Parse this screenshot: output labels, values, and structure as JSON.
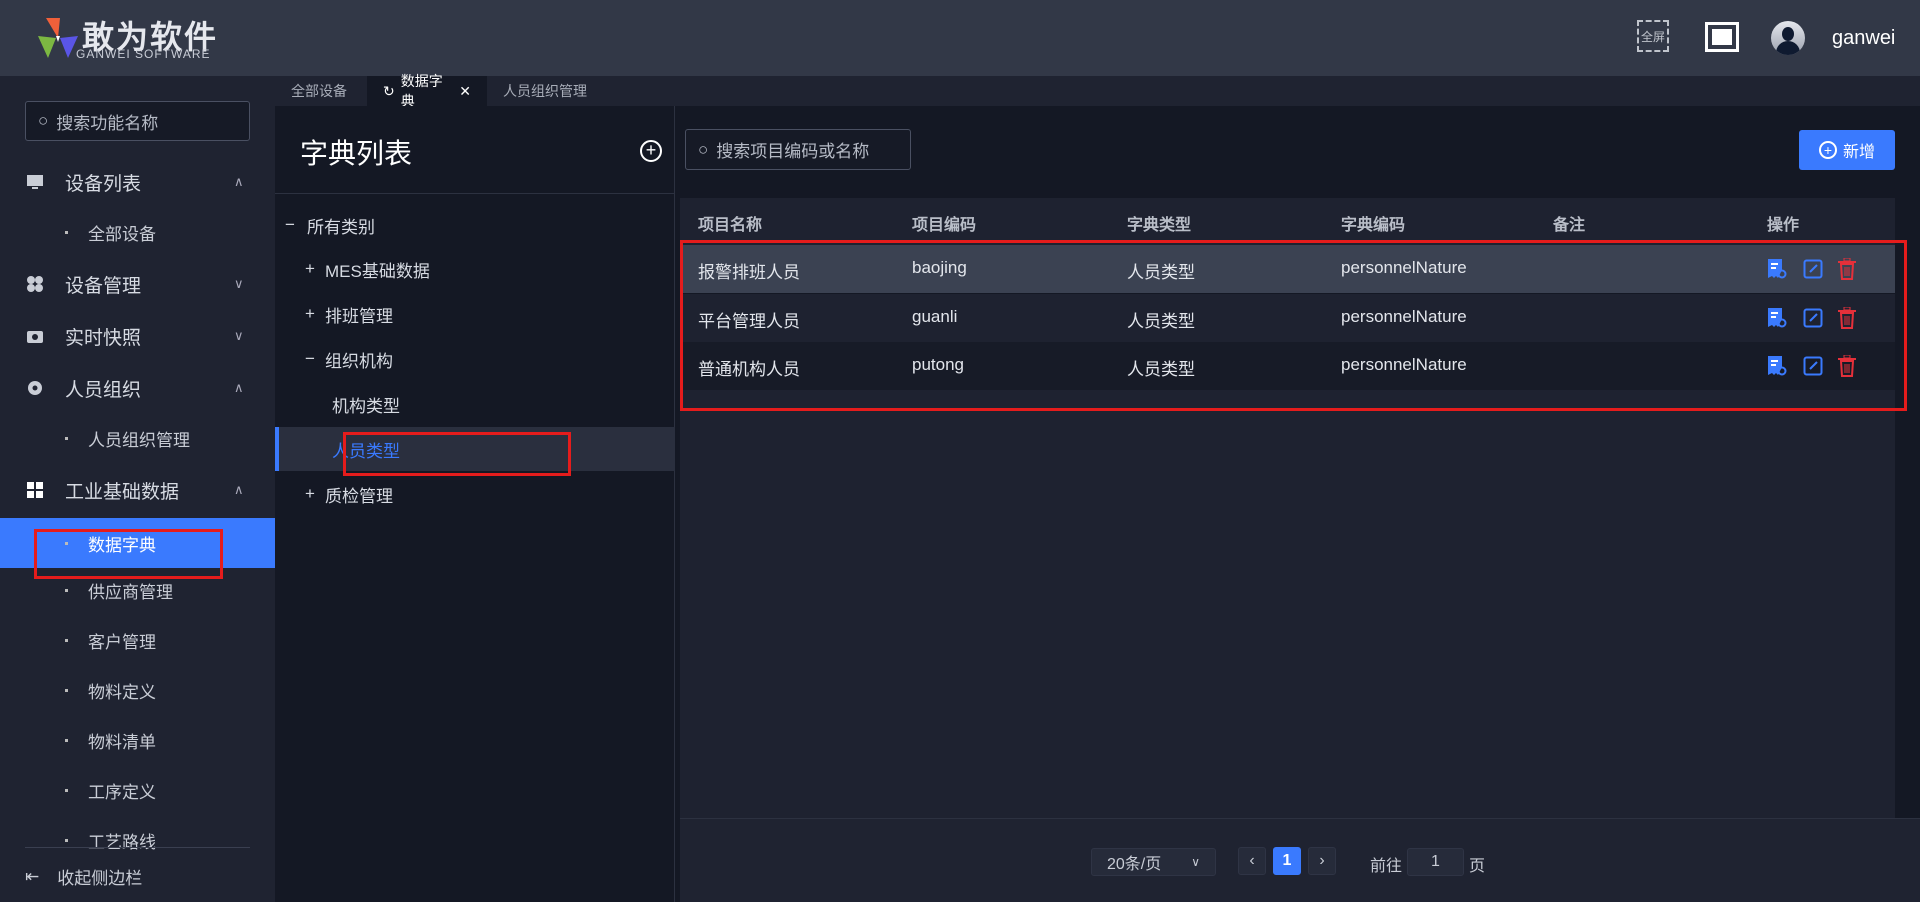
{
  "header": {
    "logo_text": "敢为软件",
    "logo_sub": "GANWEI SOFTWARE",
    "fullscreen_label": "全屏",
    "username": "ganwei"
  },
  "sidebar": {
    "search_placeholder": "搜索功能名称",
    "items": [
      {
        "label": "设备列表",
        "icon": "monitor-icon",
        "expanded": true,
        "children": [
          "全部设备"
        ]
      },
      {
        "label": "设备管理",
        "icon": "grid-flower-icon",
        "expanded": false,
        "children": []
      },
      {
        "label": "实时快照",
        "icon": "camera-icon",
        "expanded": false,
        "children": []
      },
      {
        "label": "人员组织",
        "icon": "gear-icon",
        "expanded": true,
        "children": [
          "人员组织管理"
        ]
      },
      {
        "label": "工业基础数据",
        "icon": "grid-icon",
        "expanded": true,
        "children": [
          "数据字典",
          "供应商管理",
          "客户管理",
          "物料定义",
          "物料清单",
          "工序定义",
          "工艺路线"
        ]
      }
    ],
    "active": "数据字典",
    "collapse_label": "收起侧边栏"
  },
  "tabs": [
    {
      "label": "全部设备",
      "active": false
    },
    {
      "label": "数据字典",
      "active": true
    },
    {
      "label": "人员组织管理",
      "active": false
    }
  ],
  "tree": {
    "title": "字典列表",
    "root": "所有类别",
    "nodes": [
      {
        "label": "MES基础数据",
        "sign": "+",
        "level": 1
      },
      {
        "label": "排班管理",
        "sign": "+",
        "level": 1
      },
      {
        "label": "组织机构",
        "sign": "−",
        "level": 1
      },
      {
        "label": "机构类型",
        "sign": "",
        "level": 2
      },
      {
        "label": "人员类型",
        "sign": "",
        "level": 2,
        "selected": true
      },
      {
        "label": "质检管理",
        "sign": "+",
        "level": 1
      }
    ]
  },
  "main": {
    "search_placeholder": "搜索项目编码或名称",
    "add_label": "新增",
    "columns": [
      "项目名称",
      "项目编码",
      "字典类型",
      "字典编码",
      "备注",
      "操作"
    ],
    "rows": [
      [
        "报警排班人员",
        "baojing",
        "人员类型",
        "personnelNature",
        ""
      ],
      [
        "平台管理人员",
        "guanli",
        "人员类型",
        "personnelNature",
        ""
      ],
      [
        "普通机构人员",
        "putong",
        "人员类型",
        "personnelNature",
        ""
      ]
    ],
    "pagination": {
      "page_size": "20条/页",
      "current_page": "1",
      "goto_label": "前往",
      "goto_value": "1",
      "page_unit": "页"
    }
  },
  "colors": {
    "accent": "#3a7afe",
    "danger": "#e5303a",
    "highlight_box": "#e51c1c"
  }
}
